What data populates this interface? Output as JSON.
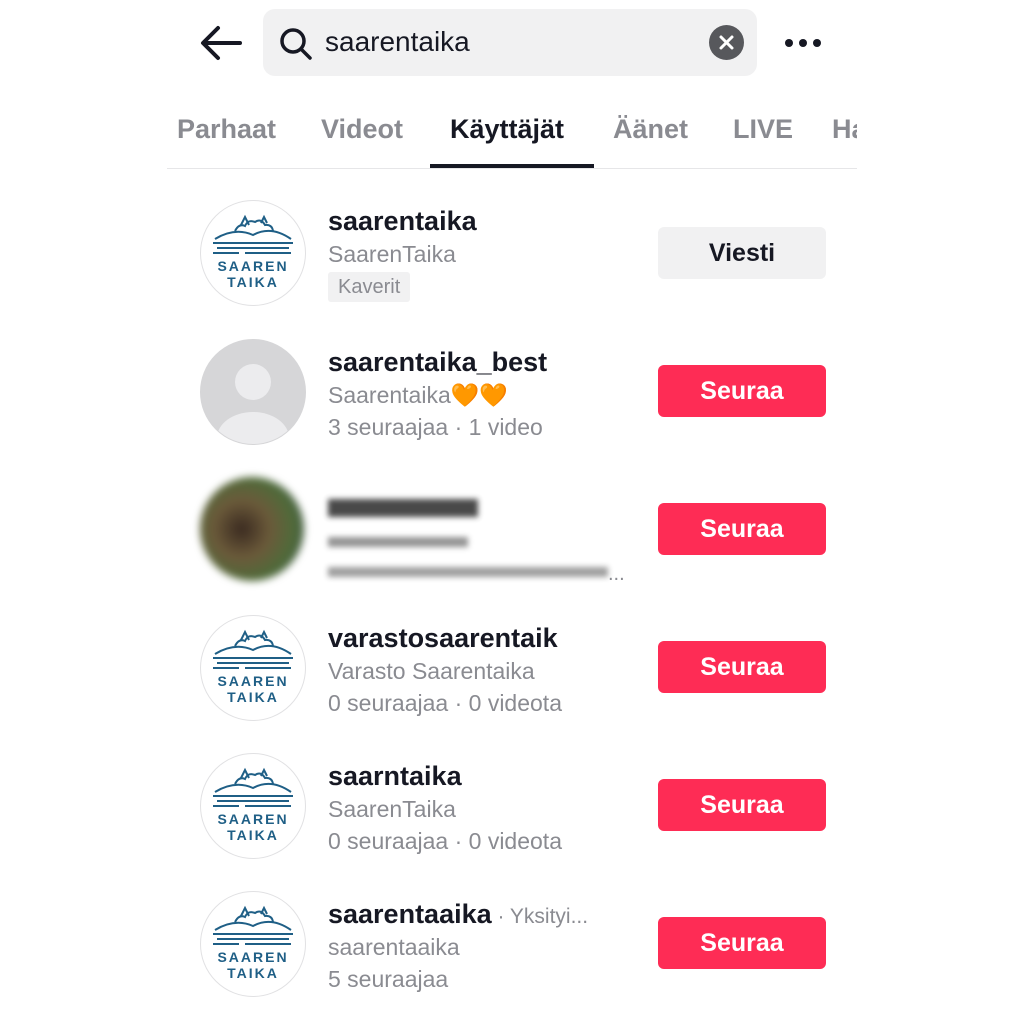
{
  "search": {
    "query": "saarentaika"
  },
  "tabs": [
    {
      "label": "Parhaat"
    },
    {
      "label": "Videot"
    },
    {
      "label": "Käyttäjät"
    },
    {
      "label": "Äänet"
    },
    {
      "label": "LIVE"
    },
    {
      "label": "Ha"
    }
  ],
  "logo_text": {
    "line1": "SAAREN",
    "line2": "TAIKA"
  },
  "results": [
    {
      "username": "saarentaika",
      "display_name": "SaarenTaika",
      "badge": "Kaverit",
      "button": "Viesti"
    },
    {
      "username": "saarentaika_best",
      "display_name": "Saarentaika🧡🧡",
      "stats": "3 seuraajaa · 1 video",
      "button": "Seuraa"
    },
    {
      "username": "",
      "display_name": "",
      "stats": "...",
      "button": "Seuraa"
    },
    {
      "username": "varastosaarentaik",
      "display_name": "Varasto Saarentaika",
      "stats": "0 seuraajaa · 0 videota",
      "button": "Seuraa"
    },
    {
      "username": "saarntaika",
      "display_name": "SaarenTaika",
      "stats": "0 seuraajaa · 0 videota",
      "button": "Seuraa"
    },
    {
      "username": "saarentaaika",
      "private_label": " · Yksityi...",
      "display_name": "saarentaaika",
      "stats": "5 seuraajaa",
      "button": "Seuraa"
    }
  ],
  "colors": {
    "follow": "#fe2c55",
    "logo": "#1f5f86",
    "muted": "#8a8b91",
    "text": "#161823"
  },
  "icons": [
    "back-arrow-icon",
    "search-icon",
    "clear-icon",
    "more-icon",
    "default-avatar-icon",
    "saarentaika-logo"
  ]
}
